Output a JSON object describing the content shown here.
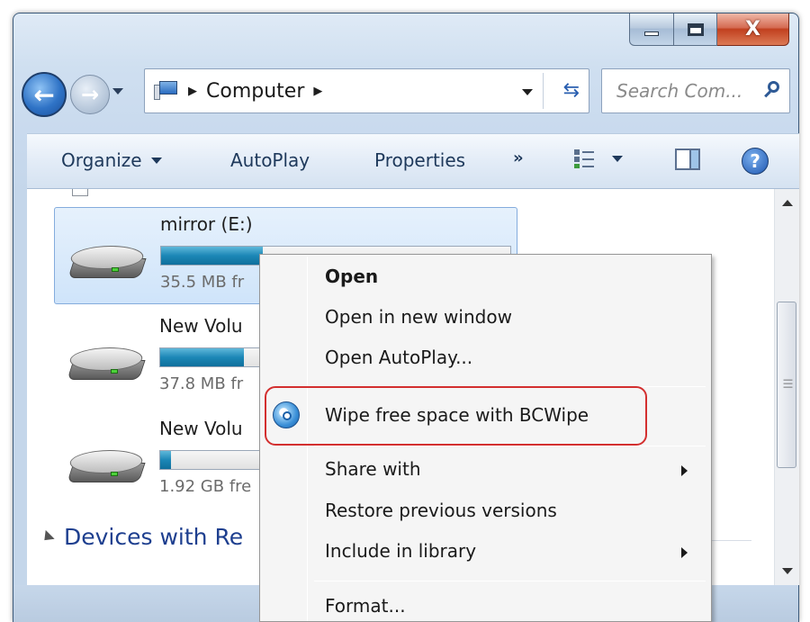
{
  "window": {
    "title_buttons": {
      "minimize": "",
      "maximize": "",
      "close": "X"
    }
  },
  "nav": {
    "address_path": [
      "Computer"
    ],
    "search_placeholder": "Search Com..."
  },
  "toolbar": {
    "organize": "Organize",
    "autoplay": "AutoPlay",
    "properties": "Properties",
    "overflow": "»"
  },
  "drives": [
    {
      "name": "mirror (E:)",
      "free_text": "35.5 MB fr",
      "used_fraction": 0.29
    },
    {
      "name": "New Volu",
      "free_text": "37.8 MB fr",
      "used_fraction": 0.24
    },
    {
      "name": "New Volu",
      "free_text": "1.92 GB fre",
      "used_fraction": 0.03
    }
  ],
  "section": {
    "devices_label": "Devices with Re"
  },
  "context_menu": {
    "items": [
      {
        "label": "Open",
        "bold": true
      },
      {
        "label": "Open in new window"
      },
      {
        "label": "Open AutoPlay..."
      },
      {
        "label": "Wipe free space with BCWipe",
        "icon": "bcwipe-icon",
        "highlighted": true
      },
      {
        "label": "Share with",
        "submenu": true
      },
      {
        "label": "Restore previous versions"
      },
      {
        "label": "Include in library",
        "submenu": true
      },
      {
        "label": "Format..."
      }
    ]
  },
  "colors": {
    "highlight_outline": "#d32f2f",
    "selection_bg": "#cfe4fa",
    "progress_fill": "#1c87b6"
  }
}
